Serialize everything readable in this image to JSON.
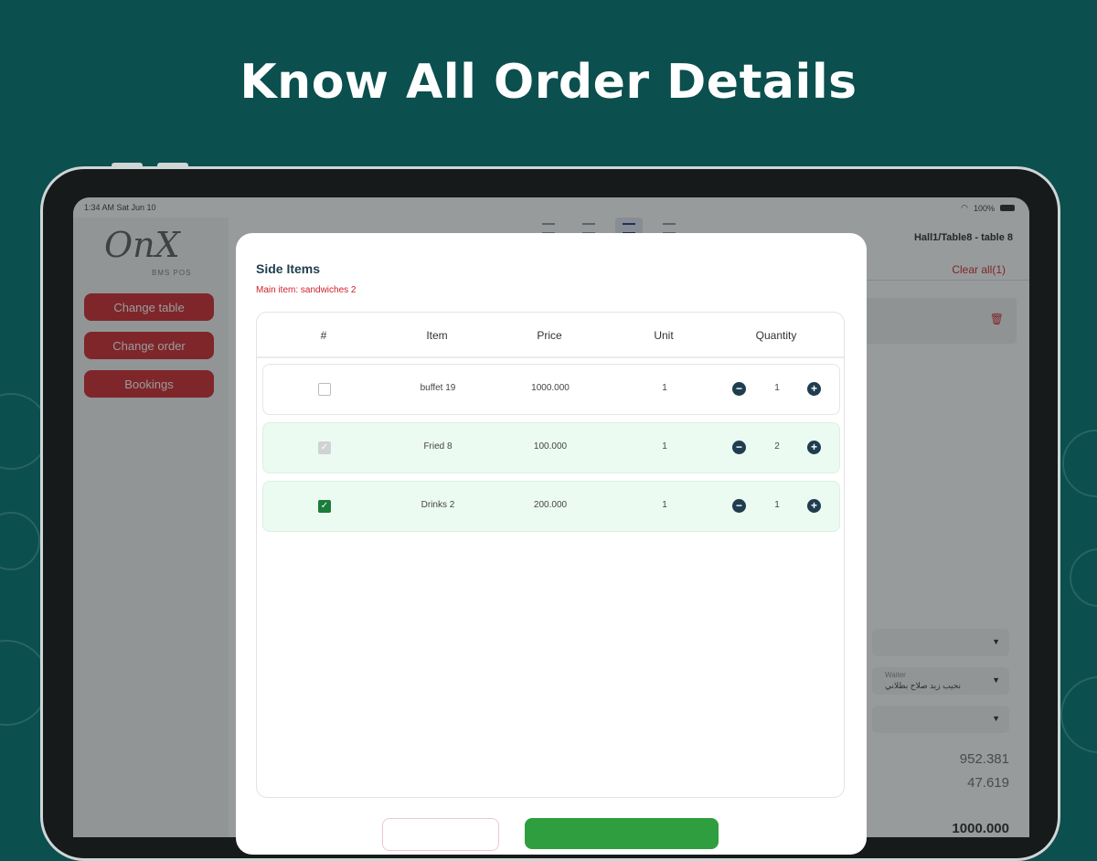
{
  "headline": "Know All Order Details",
  "status_bar": {
    "time": "1:34 AM   Sat Jun 10",
    "battery": "100%"
  },
  "sidebar": {
    "brand": "OnX",
    "brand_tagline": "BMS POS",
    "buttons": [
      {
        "label": "Change table"
      },
      {
        "label": "Change order"
      },
      {
        "label": "Bookings"
      }
    ]
  },
  "right_panel": {
    "title": "Hall1/Table8 - table 8",
    "clear_all": "Clear all(1)",
    "waiter_label": "Waiter",
    "waiter_value": "نحيب زيد صلاح بطلاني",
    "subtotal": "952.381",
    "tax": "47.619",
    "total": "1000.000"
  },
  "modal": {
    "title": "Side Items",
    "main_item": "Main item: sandwiches 2",
    "columns": {
      "index": "#",
      "item": "Item",
      "price": "Price",
      "unit": "Unit",
      "quantity": "Quantity"
    },
    "rows": [
      {
        "item": "buffet 19",
        "price": "1000.000",
        "unit": "1",
        "quantity": "1",
        "state": "unchecked"
      },
      {
        "item": "Fried 8",
        "price": "100.000",
        "unit": "1",
        "quantity": "2",
        "state": "disabled"
      },
      {
        "item": "Drinks 2",
        "price": "200.000",
        "unit": "1",
        "quantity": "1",
        "state": "checked"
      }
    ]
  },
  "glyphs": {
    "minus": "−",
    "plus": "+",
    "check": "✓",
    "trash": "🗑",
    "dropdown": "▼"
  },
  "colors": {
    "background": "#0b4f4e",
    "accent_red": "#d0202a",
    "selected_row": "#ecfbf1",
    "dark_blue": "#1f3d4f",
    "green": "#2e9e3e"
  }
}
